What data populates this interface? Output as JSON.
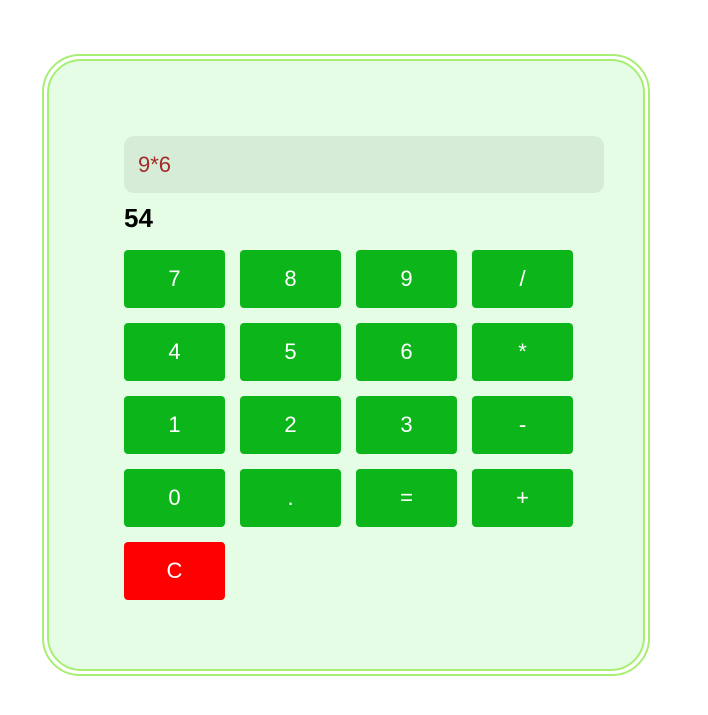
{
  "display": {
    "expression": "9*6"
  },
  "result": "54",
  "colors": {
    "panel_bg": "#e4fde4",
    "panel_border": "#a7ef73",
    "display_bg": "#d7ecd7",
    "expression_text": "#a52a2a",
    "key_bg": "#0cb51a",
    "clear_bg": "#ff0000",
    "key_text": "#ffffff"
  },
  "keys": [
    {
      "label": "7",
      "name": "key-7-button"
    },
    {
      "label": "8",
      "name": "key-8-button"
    },
    {
      "label": "9",
      "name": "key-9-button"
    },
    {
      "label": "/",
      "name": "key-divide-button"
    },
    {
      "label": "4",
      "name": "key-4-button"
    },
    {
      "label": "5",
      "name": "key-5-button"
    },
    {
      "label": "6",
      "name": "key-6-button"
    },
    {
      "label": "*",
      "name": "key-multiply-button"
    },
    {
      "label": "1",
      "name": "key-1-button"
    },
    {
      "label": "2",
      "name": "key-2-button"
    },
    {
      "label": "3",
      "name": "key-3-button"
    },
    {
      "label": "-",
      "name": "key-subtract-button"
    },
    {
      "label": "0",
      "name": "key-0-button"
    },
    {
      "label": ".",
      "name": "key-decimal-button"
    },
    {
      "label": "=",
      "name": "key-equals-button"
    },
    {
      "label": "+",
      "name": "key-add-button"
    }
  ],
  "clear_key": {
    "label": "C"
  }
}
